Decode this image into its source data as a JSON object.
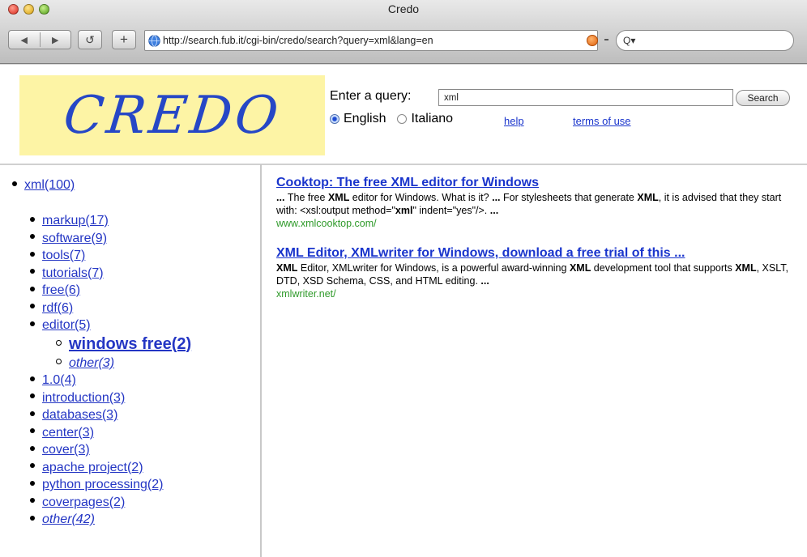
{
  "window": {
    "title": "Credo"
  },
  "toolbar": {
    "back_glyph": "◀",
    "forward_glyph": "▶",
    "reload_glyph": "↺",
    "add_glyph": "+",
    "url": "http://search.fub.it/cgi-bin/credo/search?query=xml&lang=en",
    "search_glyph": "Q▾"
  },
  "header": {
    "logo_text": "CREDO",
    "query_label": "Enter a query:",
    "query_value": "xml",
    "search_button": "Search",
    "languages": [
      {
        "label": "English",
        "selected": true
      },
      {
        "label": "Italiano",
        "selected": false
      }
    ],
    "help_link": "help",
    "terms_link": "terms of use"
  },
  "clusters": {
    "root": "xml(100)",
    "items": [
      {
        "label": "markup(17)"
      },
      {
        "label": "software(9)"
      },
      {
        "label": "tools(7)"
      },
      {
        "label": "tutorials(7)"
      },
      {
        "label": "free(6)"
      },
      {
        "label": "rdf(6)"
      },
      {
        "label": "editor(5)"
      },
      {
        "label": "windows free(2)"
      },
      {
        "label": "other(3)"
      },
      {
        "label": "1.0(4)"
      },
      {
        "label": "introduction(3)"
      },
      {
        "label": "databases(3)"
      },
      {
        "label": "center(3)"
      },
      {
        "label": "cover(3)"
      },
      {
        "label": "apache project(2)"
      },
      {
        "label": "python processing(2)"
      },
      {
        "label": "coverpages(2)"
      },
      {
        "label": "other(42)"
      }
    ]
  },
  "results": [
    {
      "title": "Cooktop: The free XML editor for Windows",
      "snippet_parts": [
        "... ",
        "The free ",
        "XML",
        " editor for Windows. What is it? ",
        "...",
        " For stylesheets that generate ",
        "XML",
        ", it is advised that they start with: <xsl:output method=\"",
        "xml",
        "\" indent=\"yes\"/>. ",
        "..."
      ],
      "url": "www.xmlcooktop.com/"
    },
    {
      "title": "XML Editor, XMLwriter for Windows, download a free trial of this ...",
      "snippet_parts": [
        "XML",
        " Editor, XMLwriter for Windows, is a powerful award-winning ",
        "XML",
        " development tool that supports ",
        "XML",
        ", XSLT, DTD, XSD Schema, CSS, and HTML editing. ",
        "..."
      ],
      "url": "xmlwriter.net/"
    }
  ]
}
